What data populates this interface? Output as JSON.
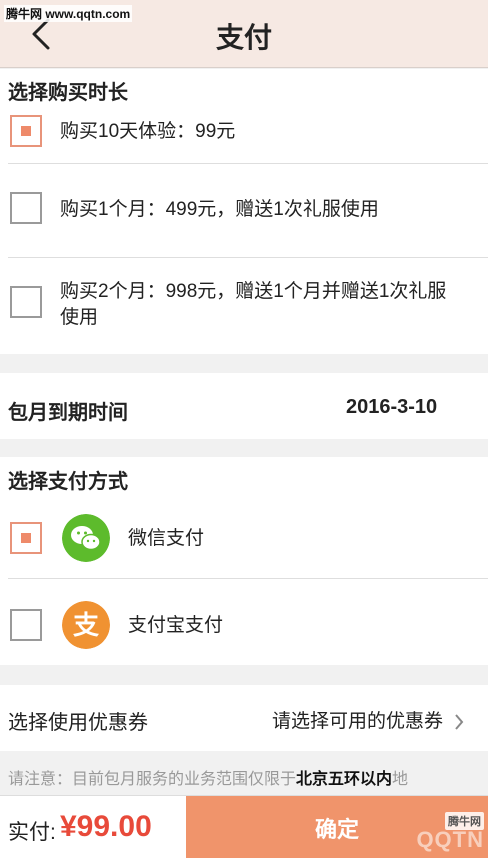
{
  "watermark": {
    "site": "腾牛网 www.qqtn.com",
    "brand": "QQTN",
    "badge": "腾牛网"
  },
  "header": {
    "title": "支付",
    "back_icon": "chevron-left-icon"
  },
  "duration": {
    "title": "选择购买时长",
    "options": [
      {
        "label": "购买10天体验：99元",
        "checked": true
      },
      {
        "label": "购买1个月：499元，赠送1次礼服使用",
        "checked": false
      },
      {
        "label_line1": "购买2个月：998元，赠送1个月并赠送1次礼服",
        "label_line2": "使用",
        "checked": false
      }
    ]
  },
  "expiry": {
    "label": "包月到期时间",
    "value": "2016-3-10"
  },
  "payment": {
    "title": "选择支付方式",
    "methods": [
      {
        "label": "微信支付",
        "icon": "wechat-icon",
        "checked": true,
        "color": "#5dbb2c"
      },
      {
        "label": "支付宝支付",
        "icon": "alipay-icon",
        "checked": false,
        "color": "#f09232"
      }
    ]
  },
  "coupon": {
    "label": "选择使用优惠券",
    "value": "请选择可用的优惠券"
  },
  "notice": {
    "prefix": "请注意：目前包月服务的业务范围仅限于",
    "highlight": "北京五环以内",
    "suffix": "地"
  },
  "footer": {
    "amount_label": "实付:",
    "amount": "¥99.00",
    "confirm_label": "确定"
  },
  "colors": {
    "accent": "#f0946b",
    "price": "#e84a3a",
    "header_bg": "#f6e9e3"
  }
}
